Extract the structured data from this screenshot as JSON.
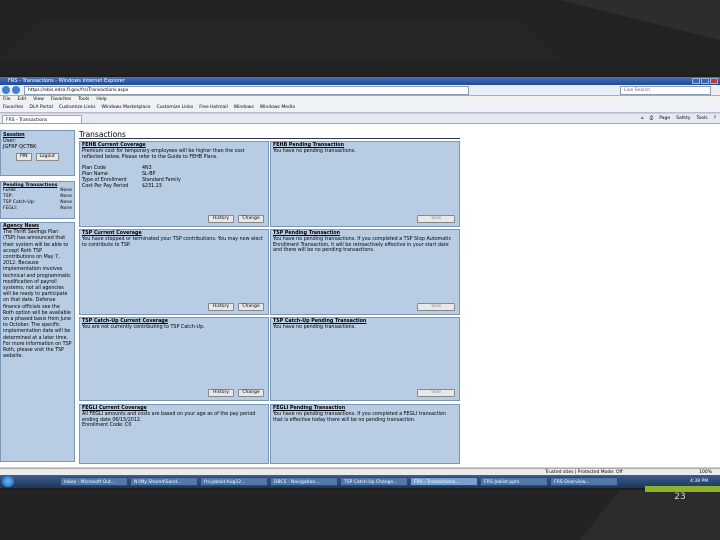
{
  "slide": {
    "page_number": "23",
    "accent_color": "#8db32b"
  },
  "browser": {
    "window_title": "FRS - Transactions - Windows Internet Explorer",
    "url": "https://ebis.edsa.fl.gov/frs/Transactions.aspx",
    "search_placeholder": "Live Search",
    "menu": [
      "File",
      "Edit",
      "View",
      "Favorites",
      "Tools",
      "Help"
    ],
    "favorites": [
      "Favorites",
      "DLA Portal",
      "Customize Links",
      "Windows Marketplace",
      "Customize Links",
      "Free Hotmail",
      "Windows",
      "Windows Media"
    ],
    "tab_label": "FRS - Transactions",
    "tools": [
      "Page",
      "Safety",
      "Tools"
    ],
    "status_zone": "Trusted sites | Protected Mode: Off",
    "zoom": "100%"
  },
  "session": {
    "heading": "Session",
    "user_label": "User:",
    "user_value": "JGFRF QCTBK",
    "pin_button": "PIN",
    "logout_button": "Logout"
  },
  "pending": {
    "heading": "Pending Transactions",
    "rows": [
      {
        "label": "FEHB:",
        "value": "None"
      },
      {
        "label": "TSP:",
        "value": "None"
      },
      {
        "label": "TSP Catch-Up:",
        "value": "None"
      },
      {
        "label": "FEGLI:",
        "value": "None"
      }
    ]
  },
  "agency_news": {
    "heading": "Agency News",
    "body": "The Thrift Savings Plan (TSP) has announced that their system will be able to accept Roth TSP contributions on May 7, 2012. Because implementation involves technical and programmatic modification of payroll systems, not all agencies will be ready to participate on that date. Defense finance officials see the Roth option will be available on a phased basis from June to October. The specific implementation date will be determined at a later time. For more information on TSP Roth, please visit the TSP website."
  },
  "page_title": "Transactions",
  "panels": {
    "fehb_current": {
      "heading": "FEHB Current Coverage",
      "text": "Premium cost for temporary employees will be higher than the cost reflected below. Please refer to the Guide to FEHB Plans.",
      "plan": [
        {
          "label": "Plan Code",
          "value": "4N3"
        },
        {
          "label": "Plan Name",
          "value": "SL-BP"
        },
        {
          "label": "Type of Enrollment",
          "value": "Standard Family"
        },
        {
          "label": "Cost Per Pay Period",
          "value": "$231.23"
        }
      ],
      "history_button": "History",
      "change_button": "Change"
    },
    "fehb_pending": {
      "heading": "FEHB Pending Transaction",
      "text": "You have no pending transactions.",
      "void_button": "Void"
    },
    "tsp_current": {
      "heading": "TSP Current Coverage",
      "text": "You have stopped or terminated your TSP contributions. You may now elect to contribute to TSP.",
      "history_button": "History",
      "change_button": "Change"
    },
    "tsp_pending": {
      "heading": "TSP Pending Transaction",
      "text": "You have no pending transactions. If you completed a TSP Stop Automatic Enrollment Transaction, it will be retroactively effective in your start date and there will be no pending transactions.",
      "void_button": "Void"
    },
    "catchup_current": {
      "heading": "TSP Catch-Up Current Coverage",
      "text": "You are not currently contributing to TSP Catch-Up.",
      "history_button": "History",
      "change_button": "Change"
    },
    "catchup_pending": {
      "heading": "TSP Catch-Up Pending Transaction",
      "text": "You have no pending transactions.",
      "void_button": "Void"
    },
    "fegli_current": {
      "heading": "FEGLI Current Coverage",
      "text": "All FEGLI amounts and costs are based on your age as of the pay period ending date 06/15/2012.",
      "enrollment": "Enrollment Code: C0"
    },
    "fegli_pending": {
      "heading": "FEGLI Pending Transaction",
      "text": "You have no pending transactions. If you completed a FEGLI transaction that is effective today there will be no pending transaction."
    }
  },
  "taskbar": {
    "items": [
      "Inbox - Microsoft Out...",
      "N:\\My Shared\\Sand...",
      "frs-jobaid-Aug12...",
      "DBCS - Navigation...",
      "TSP Catch-Up Change...",
      "FRS - Transactions...",
      "FRS-Joblist.pptx",
      "FRS-Overview..."
    ],
    "time": "4:38 PM"
  }
}
